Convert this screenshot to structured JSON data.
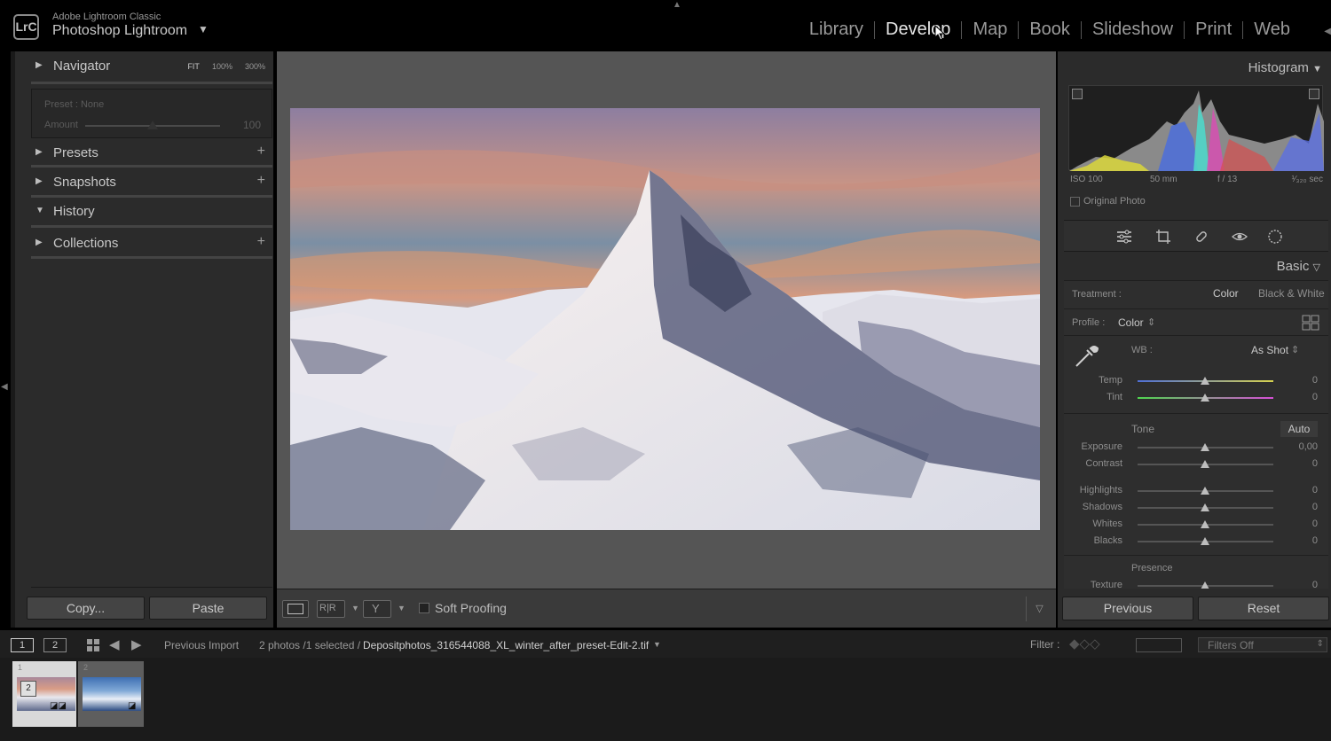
{
  "app": {
    "logo": "LrC",
    "subtitle": "Adobe Lightroom Classic",
    "name": "Photoshop Lightroom"
  },
  "modules": [
    "Library",
    "Develop",
    "Map",
    "Book",
    "Slideshow",
    "Print",
    "Web"
  ],
  "active_module": "Develop",
  "left_panel": {
    "navigator": "Navigator",
    "zoom_options": [
      "FIT",
      "100%",
      "300%"
    ],
    "preset_label": "Preset : None",
    "amount_label": "Amount",
    "amount_value": "100",
    "presets": "Presets",
    "snapshots": "Snapshots",
    "history": "History",
    "collections": "Collections",
    "copy_button": "Copy...",
    "paste_button": "Paste"
  },
  "toolbar": {
    "soft_proofing": "Soft Proofing"
  },
  "right_panel": {
    "histogram_title": "Histogram",
    "iso": "ISO 100",
    "focal": "50 mm",
    "aperture": "f / 13",
    "shutter": "¹⁄₃₂₀ sec",
    "original_photo": "Original Photo",
    "basic_title": "Basic",
    "treatment_label": "Treatment :",
    "treatment_color": "Color",
    "treatment_bw": "Black & White",
    "profile_label": "Profile :",
    "profile_value": "Color",
    "wb_label": "WB :",
    "wb_value": "As Shot",
    "tone_label": "Tone",
    "auto_label": "Auto",
    "presence_label": "Presence",
    "sliders": [
      {
        "label": "Temp",
        "value": "0"
      },
      {
        "label": "Tint",
        "value": "0"
      },
      {
        "label": "Exposure",
        "value": "0,00"
      },
      {
        "label": "Contrast",
        "value": "0"
      },
      {
        "label": "Highlights",
        "value": "0"
      },
      {
        "label": "Shadows",
        "value": "0"
      },
      {
        "label": "Whites",
        "value": "0"
      },
      {
        "label": "Blacks",
        "value": "0"
      },
      {
        "label": "Texture",
        "value": "0"
      }
    ],
    "previous_button": "Previous",
    "reset_button": "Reset"
  },
  "filmstrip": {
    "view1": "1",
    "view2": "2",
    "source": "Previous Import",
    "count": "2 photos /1 selected /",
    "filename": "Depositphotos_316544088_XL_winter_after_preset-Edit-2.tif",
    "filter_label": "Filter :",
    "filter_value": "Filters Off",
    "thumb1_index": "1",
    "thumb1_stack": "2",
    "thumb2_index": "2"
  }
}
